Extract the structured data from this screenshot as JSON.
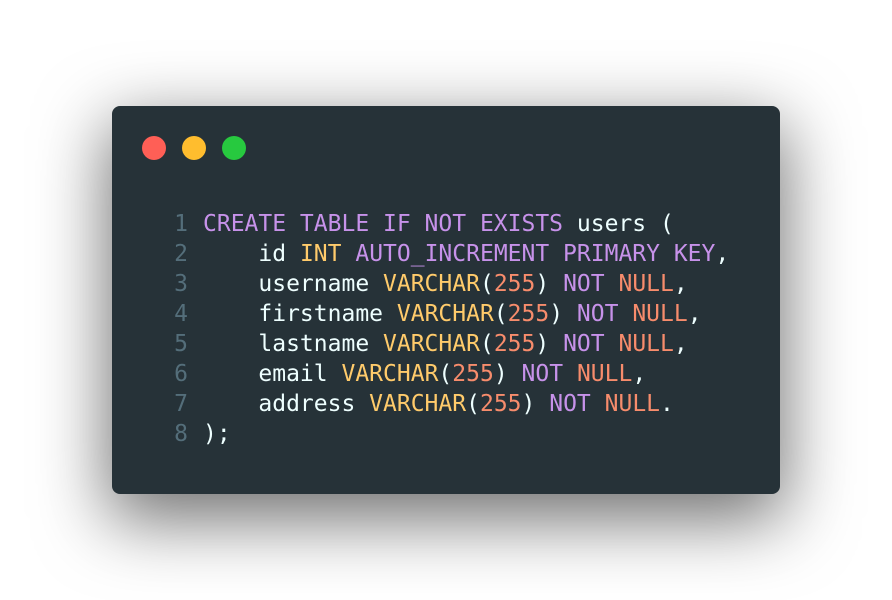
{
  "window": {
    "controls": [
      {
        "name": "close",
        "color": "#ff5f56"
      },
      {
        "name": "minimize",
        "color": "#ffbd2e"
      },
      {
        "name": "maximize",
        "color": "#27c93f"
      }
    ]
  },
  "theme": {
    "background": "#263238",
    "keyword": "#c792ea",
    "type": "#ffcb6b",
    "number": "#f78c6c",
    "punctuation": "#89ddff",
    "plain": "#eeffff",
    "line_number": "#546e7a"
  },
  "code": {
    "lines": [
      {
        "number": "1",
        "tokens": [
          {
            "t": "CREATE TABLE IF NOT EXISTS",
            "k": "keyword"
          },
          {
            "t": " users ",
            "k": "plain"
          },
          {
            "t": "(",
            "k": "plain"
          }
        ]
      },
      {
        "number": "2",
        "tokens": [
          {
            "t": "    id ",
            "k": "plain"
          },
          {
            "t": "INT",
            "k": "type"
          },
          {
            "t": " ",
            "k": "plain"
          },
          {
            "t": "AUTO_INCREMENT PRIMARY KEY",
            "k": "keyword"
          },
          {
            "t": ",",
            "k": "plain"
          }
        ]
      },
      {
        "number": "3",
        "tokens": [
          {
            "t": "    username ",
            "k": "plain"
          },
          {
            "t": "VARCHAR",
            "k": "type"
          },
          {
            "t": "(",
            "k": "plain"
          },
          {
            "t": "255",
            "k": "number"
          },
          {
            "t": ") ",
            "k": "plain"
          },
          {
            "t": "NOT",
            "k": "keyword"
          },
          {
            "t": " ",
            "k": "plain"
          },
          {
            "t": "NULL",
            "k": "number"
          },
          {
            "t": ",",
            "k": "plain"
          }
        ]
      },
      {
        "number": "4",
        "tokens": [
          {
            "t": "    firstname ",
            "k": "plain"
          },
          {
            "t": "VARCHAR",
            "k": "type"
          },
          {
            "t": "(",
            "k": "plain"
          },
          {
            "t": "255",
            "k": "number"
          },
          {
            "t": ") ",
            "k": "plain"
          },
          {
            "t": "NOT",
            "k": "keyword"
          },
          {
            "t": " ",
            "k": "plain"
          },
          {
            "t": "NULL",
            "k": "number"
          },
          {
            "t": ",",
            "k": "plain"
          }
        ]
      },
      {
        "number": "5",
        "tokens": [
          {
            "t": "    lastname ",
            "k": "plain"
          },
          {
            "t": "VARCHAR",
            "k": "type"
          },
          {
            "t": "(",
            "k": "plain"
          },
          {
            "t": "255",
            "k": "number"
          },
          {
            "t": ") ",
            "k": "plain"
          },
          {
            "t": "NOT",
            "k": "keyword"
          },
          {
            "t": " ",
            "k": "plain"
          },
          {
            "t": "NULL",
            "k": "number"
          },
          {
            "t": ",",
            "k": "plain"
          }
        ]
      },
      {
        "number": "6",
        "tokens": [
          {
            "t": "    email ",
            "k": "plain"
          },
          {
            "t": "VARCHAR",
            "k": "type"
          },
          {
            "t": "(",
            "k": "plain"
          },
          {
            "t": "255",
            "k": "number"
          },
          {
            "t": ") ",
            "k": "plain"
          },
          {
            "t": "NOT",
            "k": "keyword"
          },
          {
            "t": " ",
            "k": "plain"
          },
          {
            "t": "NULL",
            "k": "number"
          },
          {
            "t": ",",
            "k": "plain"
          }
        ]
      },
      {
        "number": "7",
        "tokens": [
          {
            "t": "    address ",
            "k": "plain"
          },
          {
            "t": "VARCHAR",
            "k": "type"
          },
          {
            "t": "(",
            "k": "plain"
          },
          {
            "t": "255",
            "k": "number"
          },
          {
            "t": ") ",
            "k": "plain"
          },
          {
            "t": "NOT",
            "k": "keyword"
          },
          {
            "t": " ",
            "k": "plain"
          },
          {
            "t": "NULL",
            "k": "number"
          },
          {
            "t": ".",
            "k": "plain"
          }
        ]
      },
      {
        "number": "8",
        "tokens": [
          {
            "t": ");",
            "k": "plain"
          }
        ]
      }
    ]
  }
}
